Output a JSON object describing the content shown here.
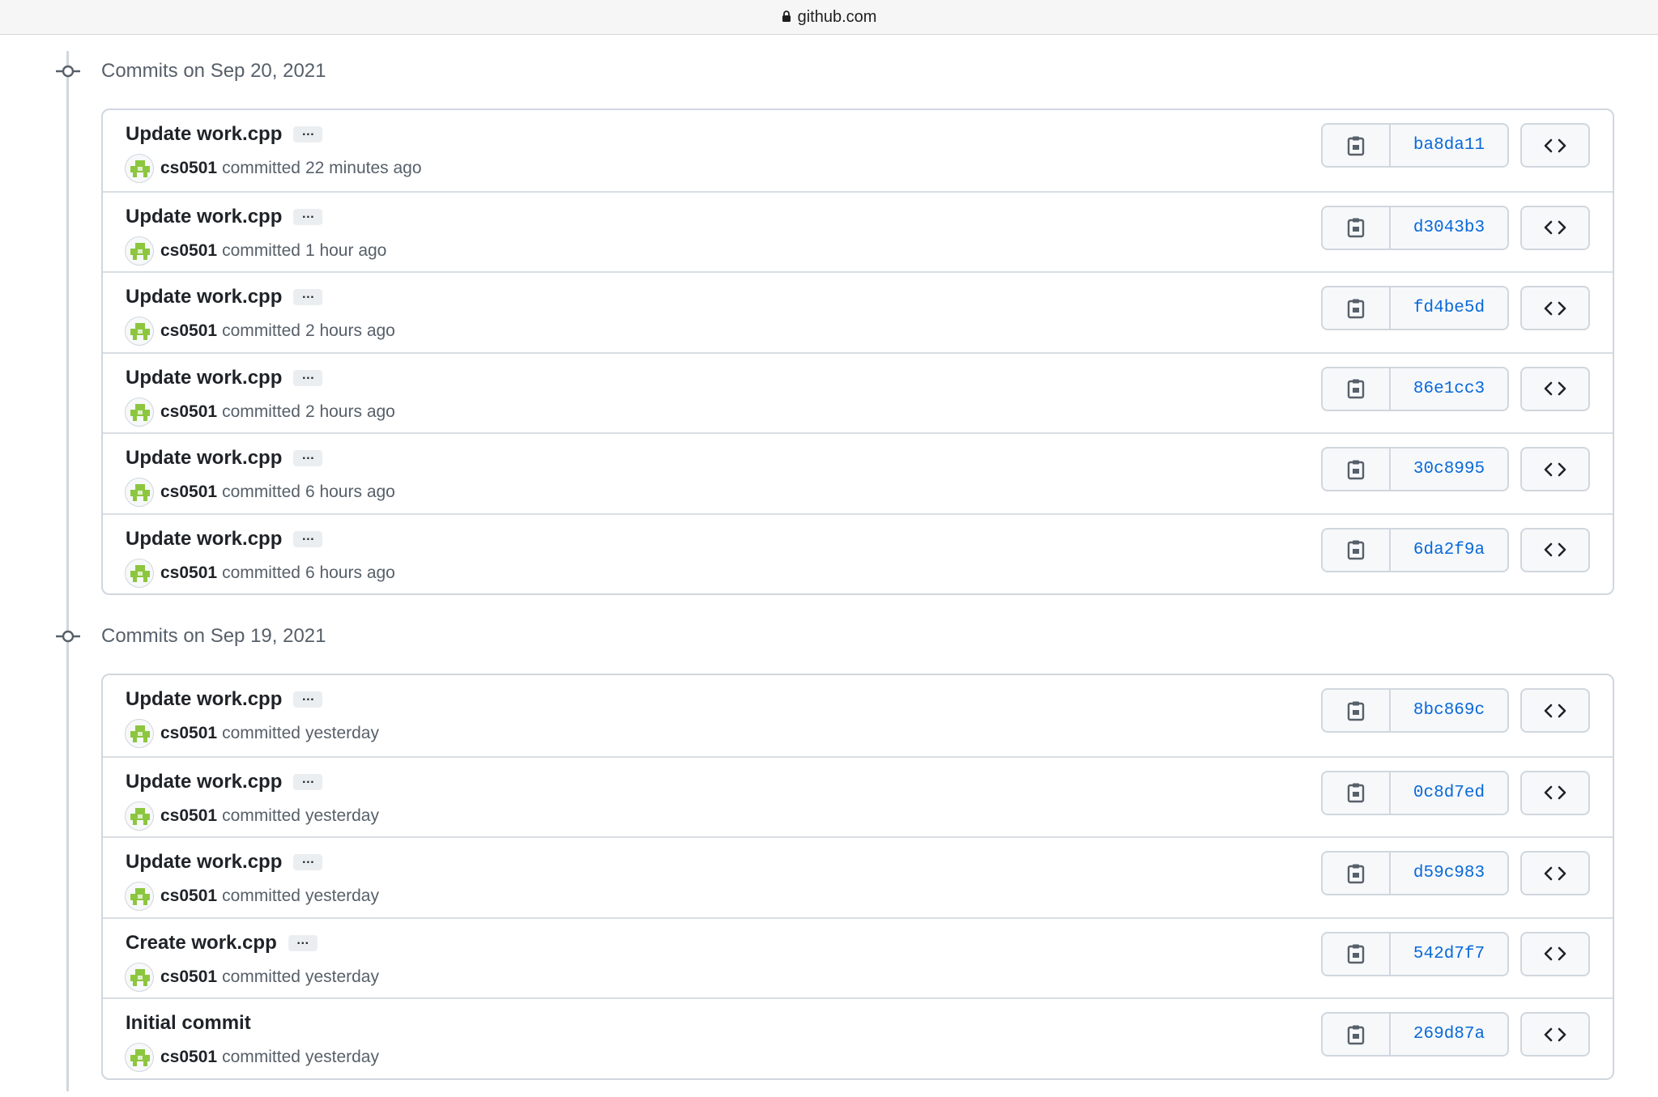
{
  "browser": {
    "url": "github.com"
  },
  "groups": [
    {
      "title": "Commits on Sep 20, 2021",
      "commits": [
        {
          "message": "Update work.cpp",
          "has_ellipsis": true,
          "author": "cs0501",
          "action": "committed",
          "time": "22 minutes ago",
          "sha": "ba8da11"
        },
        {
          "message": "Update work.cpp",
          "has_ellipsis": true,
          "author": "cs0501",
          "action": "committed",
          "time": "1 hour ago",
          "sha": "d3043b3"
        },
        {
          "message": "Update work.cpp",
          "has_ellipsis": true,
          "author": "cs0501",
          "action": "committed",
          "time": "2 hours ago",
          "sha": "fd4be5d"
        },
        {
          "message": "Update work.cpp",
          "has_ellipsis": true,
          "author": "cs0501",
          "action": "committed",
          "time": "2 hours ago",
          "sha": "86e1cc3"
        },
        {
          "message": "Update work.cpp",
          "has_ellipsis": true,
          "author": "cs0501",
          "action": "committed",
          "time": "6 hours ago",
          "sha": "30c8995"
        },
        {
          "message": "Update work.cpp",
          "has_ellipsis": true,
          "author": "cs0501",
          "action": "committed",
          "time": "6 hours ago",
          "sha": "6da2f9a"
        }
      ]
    },
    {
      "title": "Commits on Sep 19, 2021",
      "commits": [
        {
          "message": "Update work.cpp",
          "has_ellipsis": true,
          "author": "cs0501",
          "action": "committed",
          "time": "yesterday",
          "sha": "8bc869c"
        },
        {
          "message": "Update work.cpp",
          "has_ellipsis": true,
          "author": "cs0501",
          "action": "committed",
          "time": "yesterday",
          "sha": "0c8d7ed"
        },
        {
          "message": "Update work.cpp",
          "has_ellipsis": true,
          "author": "cs0501",
          "action": "committed",
          "time": "yesterday",
          "sha": "d59c983"
        },
        {
          "message": "Create work.cpp",
          "has_ellipsis": true,
          "author": "cs0501",
          "action": "committed",
          "time": "yesterday",
          "sha": "542d7f7"
        },
        {
          "message": "Initial commit",
          "has_ellipsis": false,
          "author": "cs0501",
          "action": "committed",
          "time": "yesterday",
          "sha": "269d87a"
        }
      ]
    }
  ],
  "ellipsis_label": "…",
  "icons": {
    "lock": "lock-icon",
    "commit": "git-commit-icon",
    "copy": "clipboard-icon",
    "browse": "code-icon",
    "avatar": "identicon"
  },
  "colors": {
    "sha_link": "#0969da",
    "avatar_green": "#8cc63f",
    "border": "#d0d7de"
  }
}
